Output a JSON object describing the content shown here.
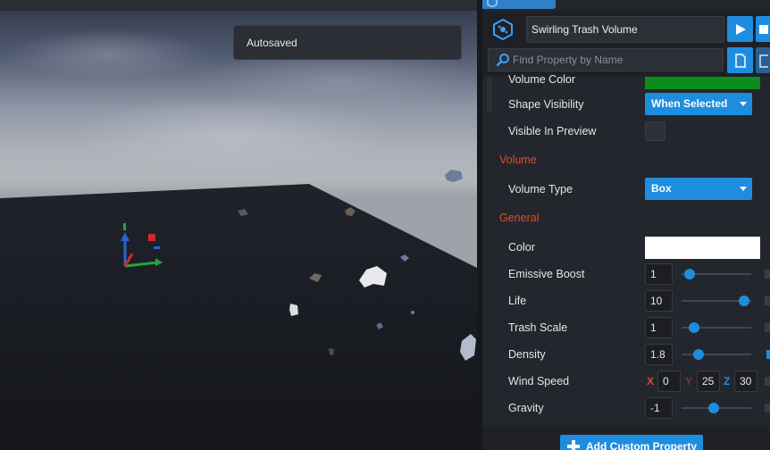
{
  "viewport": {
    "toast": "Autosaved"
  },
  "panel": {
    "object_name": "Swirling Trash Volume",
    "search_placeholder": "Find Property by Name",
    "rows": {
      "volume_color": {
        "label": "Volume Color",
        "color": "#0c8c1a"
      },
      "shape_visibility": {
        "label": "Shape Visibility",
        "value": "When Selected"
      },
      "visible_in_preview": {
        "label": "Visible In Preview"
      },
      "section_volume": "Volume",
      "volume_type": {
        "label": "Volume Type",
        "value": "Box"
      },
      "section_general": "General",
      "color": {
        "label": "Color",
        "color": "#ffffff"
      },
      "emissive_boost": {
        "label": "Emissive Boost",
        "value": "1"
      },
      "life": {
        "label": "Life",
        "value": "10"
      },
      "trash_scale": {
        "label": "Trash Scale",
        "value": "1"
      },
      "density": {
        "label": "Density",
        "value": "1.8"
      },
      "wind_speed": {
        "label": "Wind Speed",
        "x_label": "X",
        "x": "0",
        "y_label": "Y",
        "y": "25",
        "z_label": "Z",
        "z": "30"
      },
      "gravity": {
        "label": "Gravity",
        "value": "-1"
      }
    },
    "add_button": "Add Custom Property"
  },
  "colors": {
    "accent": "#1e8de0",
    "section": "#e04a2c",
    "axis_x": "#e04a2c",
    "axis_y": "#6b3d2c",
    "axis_z": "#1e8de0"
  }
}
